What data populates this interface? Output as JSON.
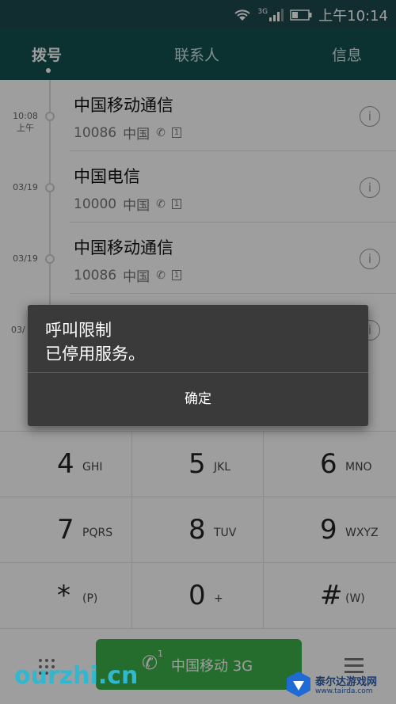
{
  "status_bar": {
    "network": "3G",
    "time": "上午10:14"
  },
  "tabs": [
    {
      "label": "拨号",
      "active": true
    },
    {
      "label": "联系人",
      "active": false
    },
    {
      "label": "信息",
      "active": false
    }
  ],
  "call_log": [
    {
      "time": "10:08",
      "time_sub": "上午",
      "name": "中国移动通信",
      "number": "10086",
      "location": "中国",
      "sim": "1"
    },
    {
      "time": "03/19",
      "time_sub": "",
      "name": "中国电信",
      "number": "10000",
      "location": "中国",
      "sim": "1"
    },
    {
      "time": "03/19",
      "time_sub": "",
      "name": "中国移动通信",
      "number": "10086",
      "location": "中国",
      "sim": "1"
    },
    {
      "time": "03/",
      "time_sub": "",
      "name": "",
      "number": "",
      "location": "",
      "sim": ""
    }
  ],
  "dialpad": {
    "keys": [
      {
        "digit": "4",
        "letters": "GHI"
      },
      {
        "digit": "5",
        "letters": "JKL"
      },
      {
        "digit": "6",
        "letters": "MNO"
      },
      {
        "digit": "7",
        "letters": "PQRS"
      },
      {
        "digit": "8",
        "letters": "TUV"
      },
      {
        "digit": "9",
        "letters": "WXYZ"
      },
      {
        "digit": "*",
        "letters": "(P)"
      },
      {
        "digit": "0",
        "letters": "+"
      },
      {
        "digit": "#",
        "letters": "(W)"
      }
    ]
  },
  "call_button": {
    "sim_index": "1",
    "label": "中国移动 3G"
  },
  "dialog": {
    "title": "呼叫限制",
    "message": "已停用服务。",
    "ok_label": "确定"
  },
  "watermark": {
    "text": "ourzhi.cn"
  },
  "logo": {
    "name": "泰尔达游戏网",
    "url": "www.tairda.com"
  },
  "colors": {
    "header": "#13504f",
    "call_green": "#3db04a",
    "dialog_bg": "#3a3a3a"
  }
}
